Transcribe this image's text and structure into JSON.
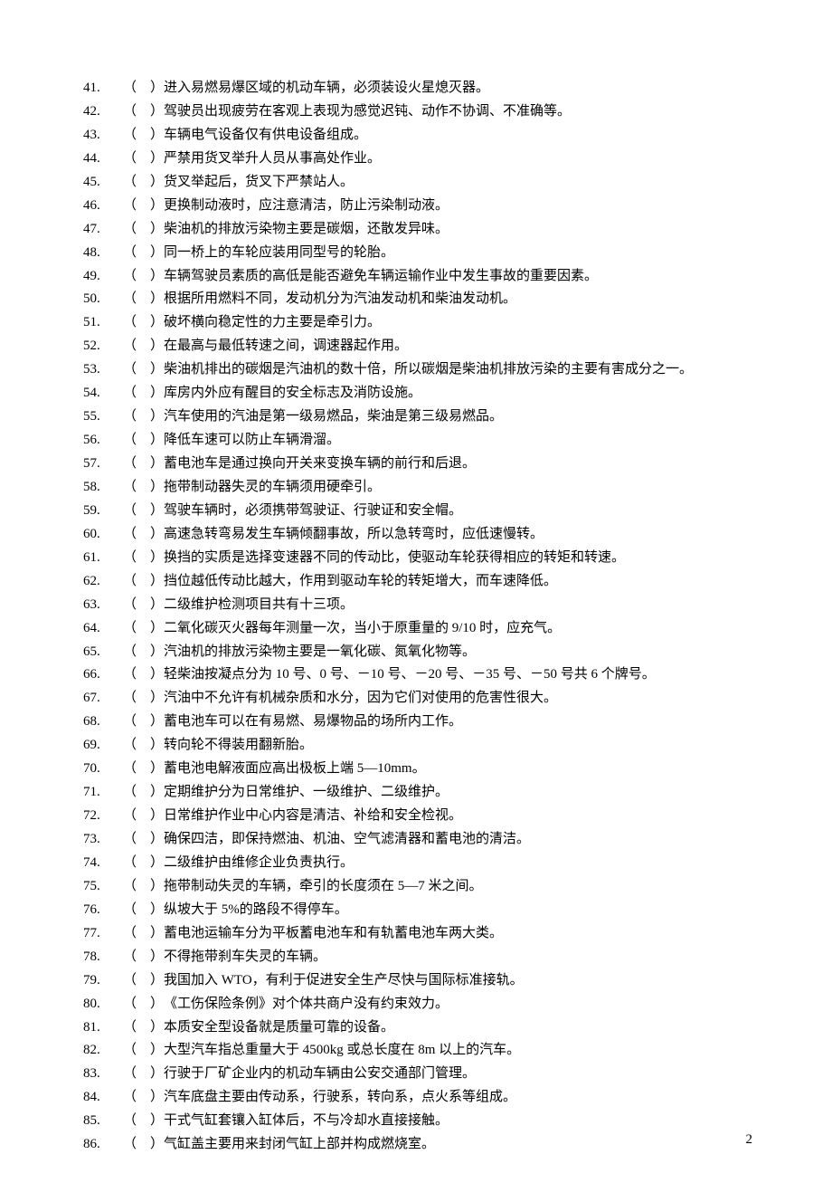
{
  "blank_marker": "（　）",
  "page_number": "2",
  "questions": [
    {
      "n": "41.",
      "t": "进入易燃易爆区域的机动车辆，必须装设火星熄灭器。"
    },
    {
      "n": "42.",
      "t": "驾驶员出现疲劳在客观上表现为感觉迟钝、动作不协调、不准确等。"
    },
    {
      "n": "43.",
      "t": "车辆电气设备仅有供电设备组成。"
    },
    {
      "n": "44.",
      "t": "严禁用货叉举升人员从事高处作业。"
    },
    {
      "n": "45.",
      "t": "货叉举起后，货叉下严禁站人。"
    },
    {
      "n": "46.",
      "t": "更换制动液时，应注意清洁，防止污染制动液。"
    },
    {
      "n": "47.",
      "t": "柴油机的排放污染物主要是碳烟，还散发异味。"
    },
    {
      "n": "48.",
      "t": "同一桥上的车轮应装用同型号的轮胎。"
    },
    {
      "n": "49.",
      "t": "车辆驾驶员素质的高低是能否避免车辆运输作业中发生事故的重要因素。"
    },
    {
      "n": "50.",
      "t": "根据所用燃料不同，发动机分为汽油发动机和柴油发动机。"
    },
    {
      "n": "51.",
      "t": "破坏横向稳定性的力主要是牵引力。"
    },
    {
      "n": "52.",
      "t": "在最高与最低转速之间，调速器起作用。"
    },
    {
      "n": "53.",
      "t": "柴油机排出的碳烟是汽油机的数十倍，所以碳烟是柴油机排放污染的主要有害成分之一。"
    },
    {
      "n": "54.",
      "t": "库房内外应有醒目的安全标志及消防设施。"
    },
    {
      "n": "55.",
      "t": "汽车使用的汽油是第一级易燃品，柴油是第三级易燃品。"
    },
    {
      "n": "56.",
      "t": "降低车速可以防止车辆滑溜。"
    },
    {
      "n": "57.",
      "t": "蓄电池车是通过换向开关来变换车辆的前行和后退。"
    },
    {
      "n": "58.",
      "t": "拖带制动器失灵的车辆须用硬牵引。"
    },
    {
      "n": "59.",
      "t": "驾驶车辆时，必须携带驾驶证、行驶证和安全帽。"
    },
    {
      "n": "60.",
      "t": "高速急转弯易发生车辆倾翻事故，所以急转弯时，应低速慢转。"
    },
    {
      "n": "61.",
      "t": "换挡的实质是选择变速器不同的传动比，使驱动车轮获得相应的转矩和转速。"
    },
    {
      "n": "62.",
      "t": "挡位越低传动比越大，作用到驱动车轮的转矩增大，而车速降低。"
    },
    {
      "n": "63.",
      "t": "二级维护检测项目共有十三项。"
    },
    {
      "n": "64.",
      "t": "二氧化碳灭火器每年测量一次，当小于原重量的 9/10 时，应充气。"
    },
    {
      "n": "65.",
      "t": "汽油机的排放污染物主要是一氧化碳、氮氧化物等。"
    },
    {
      "n": "66.",
      "t": "轻柴油按凝点分为 10 号、0 号、－10 号、－20 号、－35 号、－50 号共 6 个牌号。"
    },
    {
      "n": "67.",
      "t": "汽油中不允许有机械杂质和水分，因为它们对使用的危害性很大。"
    },
    {
      "n": "68.",
      "t": "蓄电池车可以在有易燃、易爆物品的场所内工作。"
    },
    {
      "n": "69.",
      "t": "转向轮不得装用翻新胎。"
    },
    {
      "n": "70.",
      "t": "蓄电池电解液面应高出极板上端 5—10mm。"
    },
    {
      "n": "71.",
      "t": "定期维护分为日常维护、一级维护、二级维护。"
    },
    {
      "n": "72.",
      "t": "日常维护作业中心内容是清洁、补给和安全检视。"
    },
    {
      "n": "73.",
      "t": "确保四洁，即保持燃油、机油、空气滤清器和蓄电池的清洁。"
    },
    {
      "n": "74.",
      "t": "二级维护由维修企业负责执行。"
    },
    {
      "n": "75.",
      "t": "拖带制动失灵的车辆，牵引的长度须在 5—7 米之间。"
    },
    {
      "n": "76.",
      "t": "纵坡大于 5%的路段不得停车。"
    },
    {
      "n": "77.",
      "t": "蓄电池运输车分为平板蓄电池车和有轨蓄电池车两大类。"
    },
    {
      "n": "78.",
      "t": "不得拖带刹车失灵的车辆。"
    },
    {
      "n": "79.",
      "t": " 我国加入 WTO，有利于促进安全生产尽快与国际标准接轨。"
    },
    {
      "n": "80.",
      "t": "《工伤保险条例》对个体共商户没有约束效力。"
    },
    {
      "n": "81.",
      "t": "本质安全型设备就是质量可靠的设备。"
    },
    {
      "n": "82.",
      "t": "大型汽车指总重量大于 4500kg 或总长度在 8m 以上的汽车。"
    },
    {
      "n": "83.",
      "t": "行驶于厂矿企业内的机动车辆由公安交通部门管理。"
    },
    {
      "n": "84.",
      "t": "汽车底盘主要由传动系，行驶系，转向系，点火系等组成。"
    },
    {
      "n": "85.",
      "t": "干式气缸套镶入缸体后，不与冷却水直接接触。"
    },
    {
      "n": "86.",
      "t": "气缸盖主要用来封闭气缸上部并构成燃烧室。"
    }
  ]
}
